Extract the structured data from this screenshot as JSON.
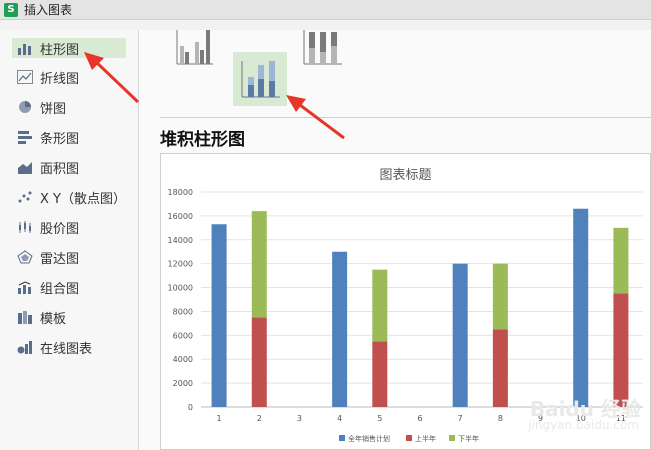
{
  "window": {
    "title": "插入图表",
    "app_icon_glyph": "S"
  },
  "sidebar": {
    "items": [
      {
        "label": "柱形图",
        "icon": "column-chart-icon",
        "active": true
      },
      {
        "label": "折线图",
        "icon": "line-chart-icon",
        "active": false
      },
      {
        "label": "饼图",
        "icon": "pie-chart-icon",
        "active": false
      },
      {
        "label": "条形图",
        "icon": "bar-chart-icon",
        "active": false
      },
      {
        "label": "面积图",
        "icon": "area-chart-icon",
        "active": false
      },
      {
        "label": "X Y（散点图）",
        "icon": "scatter-chart-icon",
        "active": false
      },
      {
        "label": "股价图",
        "icon": "stock-chart-icon",
        "active": false
      },
      {
        "label": "雷达图",
        "icon": "radar-chart-icon",
        "active": false
      },
      {
        "label": "组合图",
        "icon": "combo-chart-icon",
        "active": false
      },
      {
        "label": "模板",
        "icon": "template-icon",
        "active": false
      },
      {
        "label": "在线图表",
        "icon": "online-chart-icon",
        "active": false
      }
    ]
  },
  "subtypes": {
    "selected_title": "堆积柱形图",
    "items": [
      {
        "name": "clustered-column",
        "active": false
      },
      {
        "name": "stacked-column",
        "active": true
      },
      {
        "name": "percent-stacked-column",
        "active": false
      }
    ]
  },
  "colors": {
    "series1": "#4f81bd",
    "series2": "#c0504d",
    "series3": "#9bbb59",
    "accent": "#d8ead3",
    "arrow": "#e8352a"
  },
  "chart_data": {
    "type": "bar",
    "stacked": true,
    "title": "图表标题",
    "categories": [
      "1",
      "2",
      "3",
      "4",
      "5",
      "6",
      "7",
      "8",
      "9",
      "10",
      "11"
    ],
    "series": [
      {
        "name": "全年销售计划",
        "values": [
          15300,
          0,
          0,
          13000,
          0,
          0,
          12000,
          0,
          0,
          16600,
          0
        ]
      },
      {
        "name": "上半年",
        "values": [
          0,
          7500,
          0,
          0,
          5500,
          0,
          0,
          6500,
          0,
          0,
          9500
        ]
      },
      {
        "name": "下半年",
        "values": [
          0,
          8900,
          0,
          0,
          6000,
          0,
          0,
          5500,
          0,
          0,
          5500
        ]
      }
    ],
    "yticks": [
      "0",
      "2000",
      "4000",
      "6000",
      "8000",
      "10000",
      "12000",
      "14000",
      "16000",
      "18000"
    ],
    "ylim": [
      0,
      18000
    ],
    "legend_position": "bottom"
  },
  "watermark": {
    "line1": "Baidu 经验",
    "line2": "jingyan.baidu.com"
  }
}
